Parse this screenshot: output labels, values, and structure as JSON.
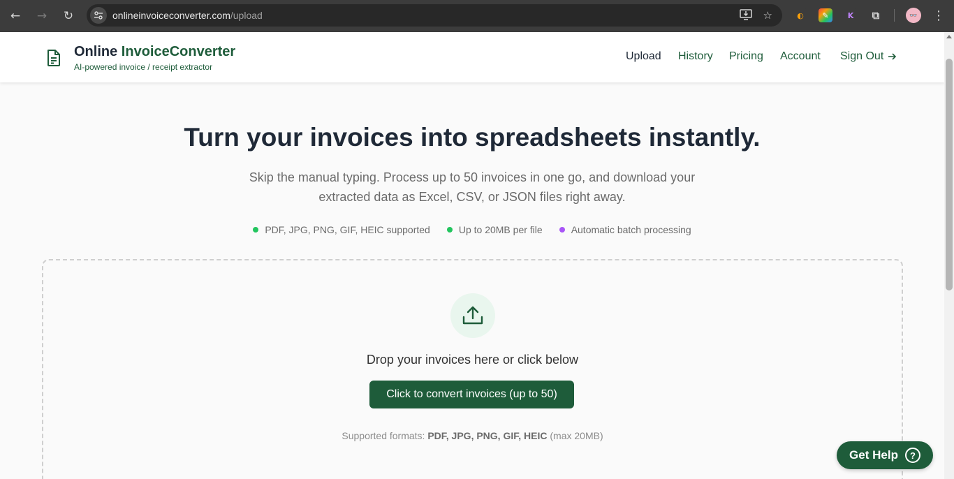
{
  "browser": {
    "url_host": "onlineinvoiceconverter.com",
    "url_path": "/upload",
    "avatar_text": "👓"
  },
  "header": {
    "brand_prefix": "Online ",
    "brand_accent": "InvoiceConverter",
    "tagline": "AI-powered invoice / receipt extractor",
    "nav": {
      "upload": "Upload",
      "history": "History",
      "pricing": "Pricing",
      "account": "Account",
      "sign_out": "Sign Out"
    }
  },
  "hero": {
    "title": "Turn your invoices into spreadsheets instantly.",
    "subtitle": "Skip the manual typing. Process up to 50 invoices in one go, and download your extracted data as Excel, CSV, or JSON files right away."
  },
  "features": [
    {
      "label": "PDF, JPG, PNG, GIF, HEIC supported",
      "color": "#22c55e"
    },
    {
      "label": "Up to 20MB per file",
      "color": "#22c55e"
    },
    {
      "label": "Automatic batch processing",
      "color": "#a855f7"
    }
  ],
  "dropzone": {
    "prompt": "Drop your invoices here or click below",
    "button_label": "Click to convert invoices (up to 50)",
    "formats_prefix": "Supported formats: ",
    "formats_list": "PDF, JPG, PNG, GIF, HEIC",
    "formats_suffix": " (max 20MB)"
  },
  "help": {
    "label": "Get Help",
    "icon": "?"
  },
  "colors": {
    "brand_green": "#1e5c3a",
    "feature_green": "#22c55e",
    "feature_purple": "#a855f7"
  }
}
